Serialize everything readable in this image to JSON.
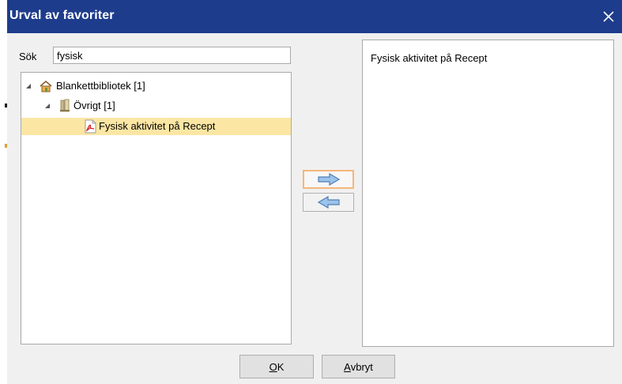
{
  "window": {
    "title": "Urval av favoriter",
    "close_glyph": "✕"
  },
  "search": {
    "label": "Sök",
    "value": "fysisk"
  },
  "tree": {
    "root": {
      "label": "Blankettbibliotek [1]",
      "icon": "library-house-icon"
    },
    "folder": {
      "label": "Övrigt [1]",
      "icon": "folder-icon"
    },
    "leaf": {
      "label": "Fysisk aktivitet på Recept",
      "icon": "pdf-document-icon"
    }
  },
  "transfer": {
    "add_icon": "arrow-right-icon",
    "remove_icon": "arrow-left-icon"
  },
  "selected_list": {
    "items": [
      "Fysisk aktivitet på Recept"
    ]
  },
  "buttons": {
    "ok": {
      "mnemonic": "O",
      "rest": "K"
    },
    "cancel": {
      "mnemonic": "A",
      "rest": "vbryt"
    }
  },
  "colors": {
    "titlebar": "#1e3c8c",
    "selection": "#fbe6a4",
    "arrow": "#7aa7d6",
    "focus_border": "#f5b77a"
  }
}
